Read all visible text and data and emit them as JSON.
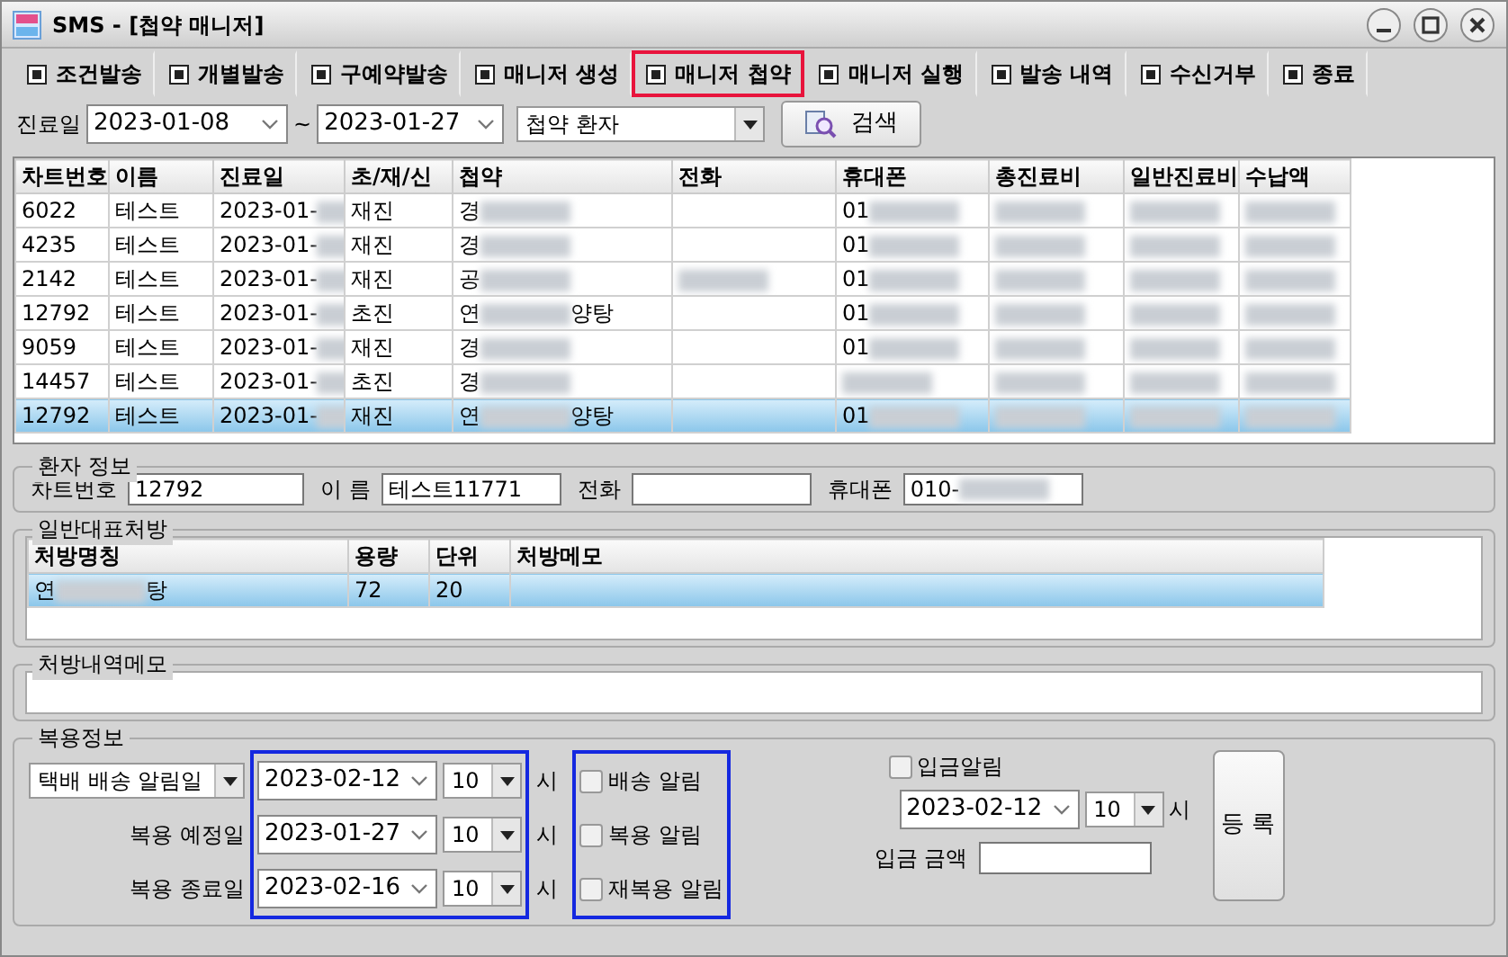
{
  "window": {
    "title": "SMS - [첩약 매니저]"
  },
  "toolbar": [
    {
      "label": "조건발송",
      "selected": false
    },
    {
      "label": "개별발송",
      "selected": false
    },
    {
      "label": "구예약발송",
      "selected": false
    },
    {
      "label": "매니저 생성",
      "selected": false
    },
    {
      "label": "매니저 첩약",
      "selected": true
    },
    {
      "label": "매니저 실행",
      "selected": false
    },
    {
      "label": "발송 내역",
      "selected": false
    },
    {
      "label": "수신거부",
      "selected": false
    },
    {
      "label": "종료",
      "selected": false
    }
  ],
  "filter": {
    "label": "진료일",
    "date_from": "2023-01-08",
    "separator": "~",
    "date_to": "2023-01-27",
    "category": "첩약 환자",
    "search_button": "검색"
  },
  "table": {
    "columns": [
      "차트번호",
      "이름",
      "진료일",
      "초/재/신",
      "첩약",
      "전화",
      "휴대폰",
      "총진료비",
      "일반진료비",
      "수납액"
    ],
    "rows": [
      {
        "selected": false,
        "cells": [
          "6022",
          "테스트",
          {
            "text": "2023-01-",
            "blur": true
          },
          "재진",
          {
            "text": "경",
            "blur": true
          },
          "",
          {
            "text": "01",
            "blur": true
          },
          {
            "text": "",
            "blur": true
          },
          {
            "text": "",
            "blur": true
          },
          {
            "text": "",
            "blur": true
          }
        ]
      },
      {
        "selected": false,
        "cells": [
          "4235",
          "테스트",
          {
            "text": "2023-01-",
            "blur": true
          },
          "재진",
          {
            "text": "경",
            "blur": true
          },
          "",
          {
            "text": "01",
            "blur": true
          },
          {
            "text": "",
            "blur": true
          },
          {
            "text": "",
            "blur": true
          },
          {
            "text": "",
            "blur": true
          }
        ]
      },
      {
        "selected": false,
        "cells": [
          "2142",
          "테스트",
          {
            "text": "2023-01-",
            "blur": true
          },
          "재진",
          {
            "text": "공",
            "blur": true
          },
          {
            "text": "",
            "blur": true
          },
          {
            "text": "01",
            "blur": true
          },
          {
            "text": "",
            "blur": true
          },
          {
            "text": "",
            "blur": true
          },
          {
            "text": "",
            "blur": true
          }
        ]
      },
      {
        "selected": false,
        "cells": [
          "12792",
          "테스트",
          {
            "text": "2023-01-",
            "blur": true
          },
          "초진",
          {
            "text": "연",
            "blur": true,
            "after": "양탕"
          },
          "",
          {
            "text": "01",
            "blur": true
          },
          {
            "text": "",
            "blur": true
          },
          {
            "text": "",
            "blur": true
          },
          {
            "text": "",
            "blur": true
          }
        ]
      },
      {
        "selected": false,
        "cells": [
          "9059",
          "테스트",
          {
            "text": "2023-01-",
            "blur": true
          },
          "재진",
          {
            "text": "경",
            "blur": true
          },
          "",
          {
            "text": "01",
            "blur": true
          },
          {
            "text": "",
            "blur": true
          },
          {
            "text": "",
            "blur": true
          },
          {
            "text": "",
            "blur": true
          }
        ]
      },
      {
        "selected": false,
        "cells": [
          "14457",
          "테스트",
          {
            "text": "2023-01-",
            "blur": true
          },
          "초진",
          {
            "text": "경",
            "blur": true
          },
          "",
          {
            "text": "",
            "blur": true
          },
          {
            "text": "",
            "blur": true
          },
          {
            "text": "",
            "blur": true
          },
          {
            "text": "",
            "blur": true
          }
        ]
      },
      {
        "selected": true,
        "cells": [
          "12792",
          "테스트",
          {
            "text": "2023-01-",
            "blur": true
          },
          "재진",
          {
            "text": "연",
            "blur": true,
            "after": "양탕"
          },
          "",
          {
            "text": "01",
            "blur": true
          },
          {
            "text": "",
            "blur": true
          },
          {
            "text": "",
            "blur": true
          },
          {
            "text": "",
            "blur": true
          }
        ]
      }
    ]
  },
  "patient_info": {
    "title": "환자 정보",
    "fields": [
      {
        "label": "차트번호",
        "value": "12792"
      },
      {
        "label": "이 름",
        "value": "테스트11771"
      },
      {
        "label": "전화"
      },
      {
        "label": "휴대폰",
        "value": "010-",
        "blur": true
      }
    ]
  },
  "prescription": {
    "title": "일반대표처방",
    "columns": [
      "처방명칭",
      "용량",
      "단위",
      "처방메모"
    ],
    "rows": [
      {
        "selected": true,
        "cells": [
          {
            "text": "연",
            "blur": true,
            "after": "탕"
          },
          "72",
          "20"
        ]
      }
    ]
  },
  "memo": {
    "title": "처방내역메모"
  },
  "dosage": {
    "title": "복용정보",
    "date_frame_highlighted": true,
    "alert_frame_highlighted": true,
    "rows": [
      {
        "kind": "select",
        "label": "택배 배송 알림일",
        "date": "2023-02-12",
        "hour": "10",
        "unit": "시",
        "alert": "배송 알림",
        "checked": false
      },
      {
        "kind": "label",
        "label": "복용 예정일",
        "date": "2023-01-27",
        "hour": "10",
        "unit": "시",
        "alert": "복용 알림",
        "checked": false
      },
      {
        "kind": "label",
        "label": "복용 종료일",
        "date": "2023-02-16",
        "hour": "10",
        "unit": "시",
        "alert": "재복용 알림",
        "checked": false
      }
    ],
    "deposit": {
      "alert": "입금알림",
      "checked": false,
      "date": "2023-02-12",
      "hour": "10",
      "unit": "시",
      "amount_label": "입금 금액"
    },
    "register_button": "등 록"
  }
}
